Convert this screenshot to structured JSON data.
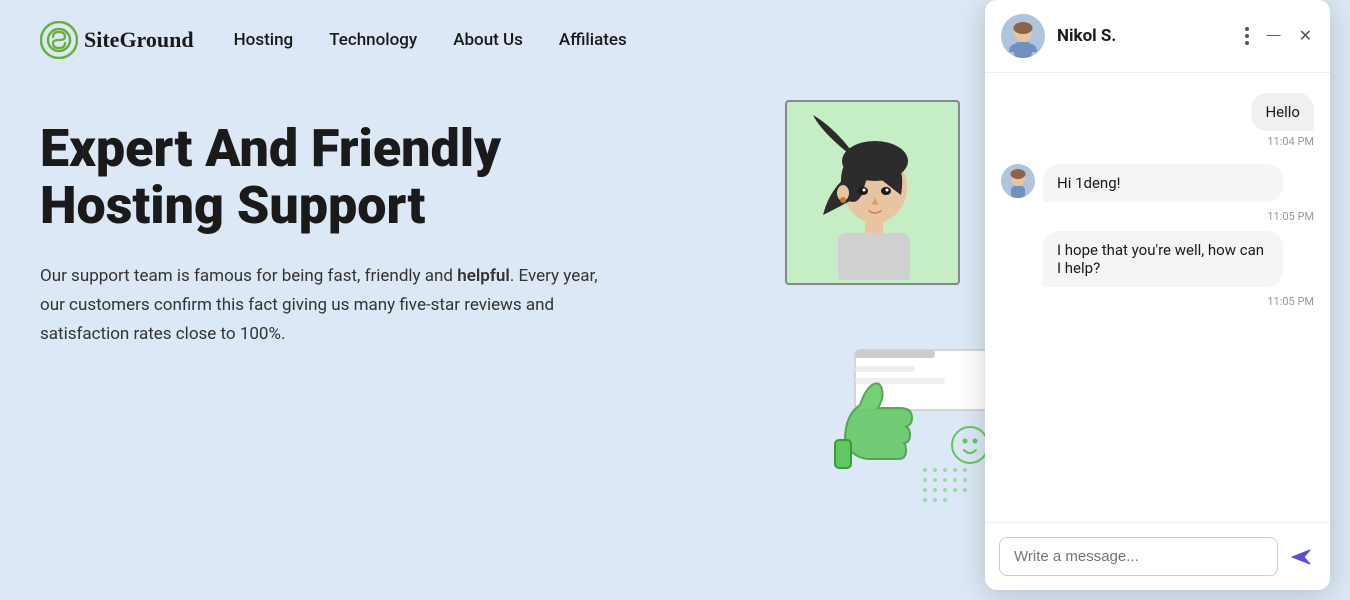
{
  "brand": {
    "name": "SiteGround",
    "logo_alt": "SiteGround logo"
  },
  "nav": {
    "links": [
      {
        "label": "Hosting",
        "id": "hosting"
      },
      {
        "label": "Technology",
        "id": "technology"
      },
      {
        "label": "About Us",
        "id": "about-us"
      },
      {
        "label": "Affiliates",
        "id": "affiliates"
      }
    ]
  },
  "hero": {
    "title": "Expert And Friendly Hosting Support",
    "description": "Our support team is famous for being fast, friendly and helpful. Every year, our customers confirm this fact giving us many five-star reviews and satisfaction rates close to 100%.",
    "highlight_word": "helpful"
  },
  "chat": {
    "agent_name": "Nikol S.",
    "messages": [
      {
        "type": "right",
        "text": "Hello",
        "time": "11:04 PM"
      },
      {
        "type": "left",
        "text": "Hi 1deng!",
        "time": "11:05 PM"
      },
      {
        "type": "left",
        "text": "I hope that you're well, how can I help?",
        "time": "11:05 PM"
      }
    ],
    "input_placeholder": "Write a message...",
    "icons": {
      "more": "⋮",
      "minimize": "—",
      "close": "✕",
      "send": "➤"
    }
  },
  "colors": {
    "accent": "#5b4fcf",
    "background": "#dce8f5",
    "chat_bg": "#ffffff"
  }
}
